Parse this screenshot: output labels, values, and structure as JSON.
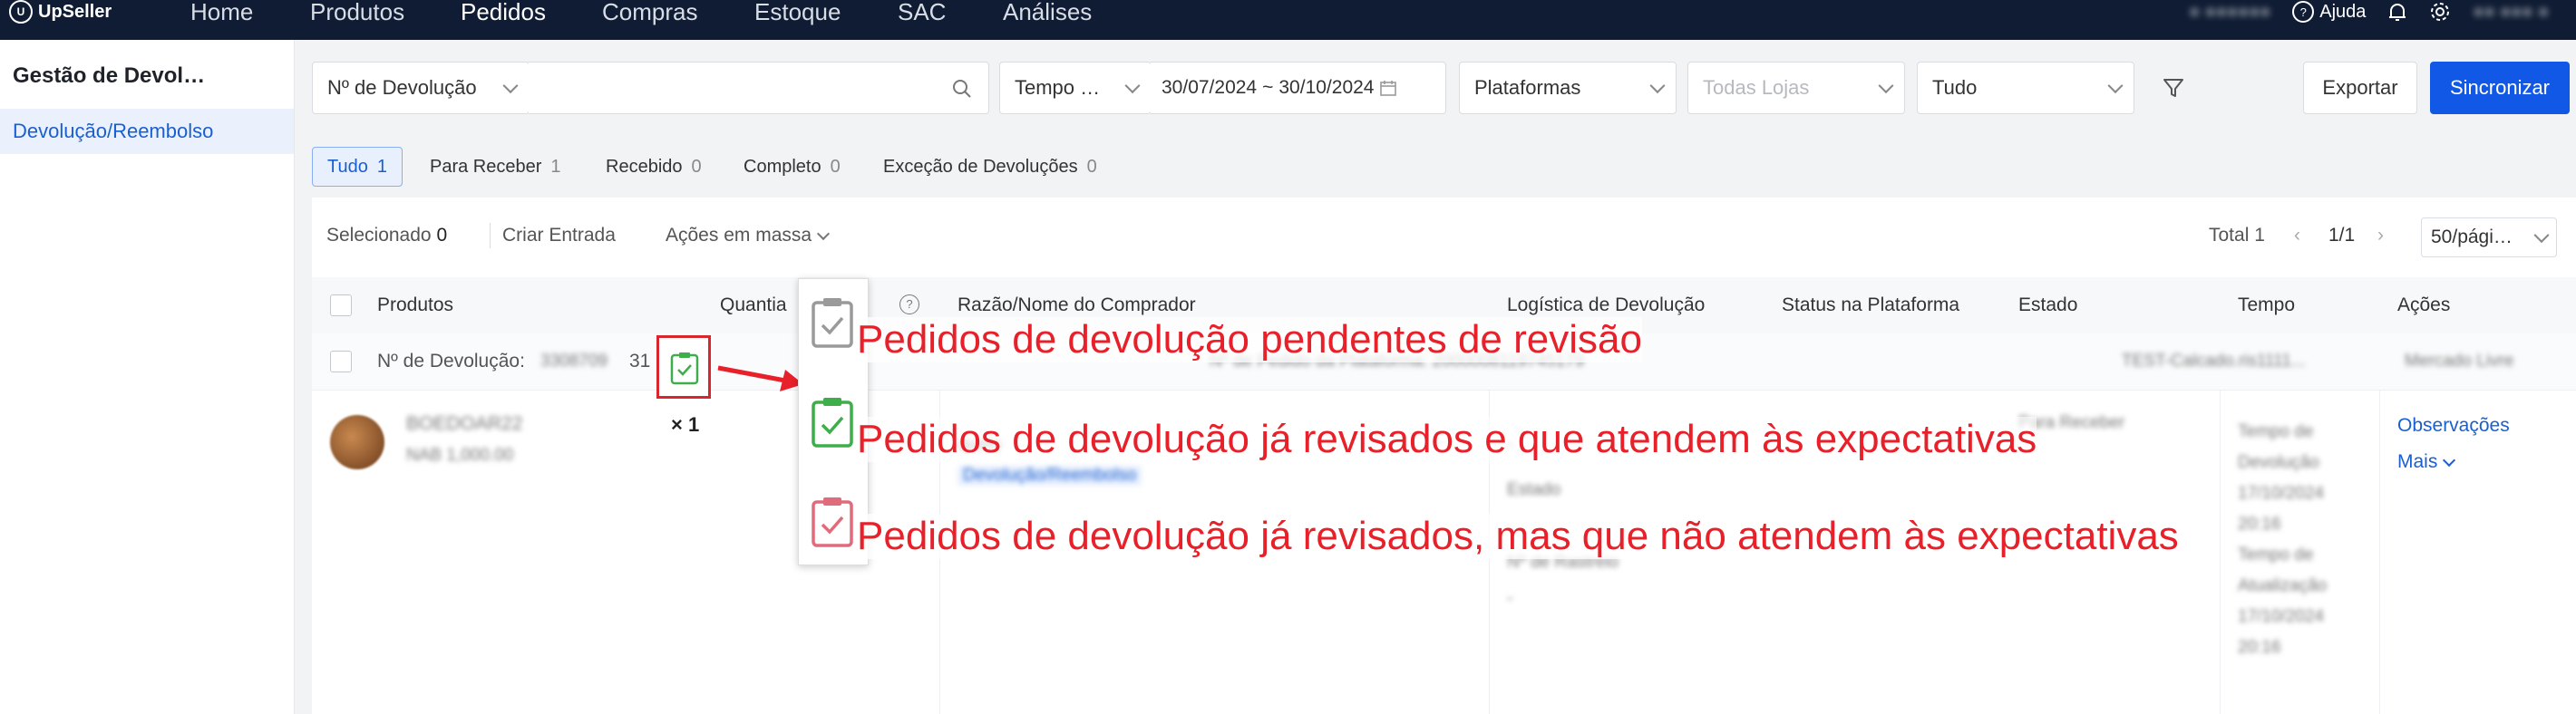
{
  "app": {
    "logo_text": "UpSeller"
  },
  "topnav": {
    "items": [
      "Home",
      "Produtos",
      "Pedidos",
      "Compras",
      "Estoque",
      "SAC",
      "Análises"
    ],
    "active": "Pedidos",
    "help_label": "Ajuda"
  },
  "sidebar": {
    "title": "Gestão de Devol…",
    "item": "Devolução/Reembolso"
  },
  "filters": {
    "search_type": "Nº de Devolução",
    "time_label": "Tempo …",
    "date_start": "30/07/2024",
    "date_sep": "~",
    "date_end": "30/10/2024",
    "platforms": "Plataformas",
    "stores_placeholder": "Todas Lojas",
    "status": "Tudo"
  },
  "actions": {
    "export": "Exportar",
    "sync": "Sincronizar"
  },
  "tabs": [
    {
      "label": "Tudo",
      "count": "1"
    },
    {
      "label": "Para Receber",
      "count": "1"
    },
    {
      "label": "Recebido",
      "count": "0"
    },
    {
      "label": "Completo",
      "count": "0"
    },
    {
      "label": "Exceção de Devoluções",
      "count": "0"
    }
  ],
  "toolbar": {
    "selected_label": "Selecionado",
    "selected_count": "0",
    "create_entry": "Criar Entrada",
    "bulk_actions": "Ações em massa",
    "total": "Total 1",
    "page": "1/1",
    "page_size": "50/pági…"
  },
  "table": {
    "headers": [
      "Produtos",
      "Quantia",
      "Razão/Nome do Comprador",
      "Logística de Devolução",
      "Status na Plataforma",
      "Estado",
      "Tempo",
      "Ações"
    ],
    "return_no_label": "Nº de Devolução:",
    "return_no_suffix": "31",
    "quantity": "× 1",
    "actions": {
      "notes": "Observações",
      "more": "Mais"
    }
  },
  "annotations": [
    "Pedidos de devolução pendentes de revisão",
    "Pedidos de devolução já revisados e que atendem às expectativas",
    "Pedidos de devolução já revisados, mas que não atendem às expectativas"
  ],
  "colors": {
    "topbar": "#0f1c33",
    "primary": "#1158e6",
    "annotation": "#e8202a",
    "check_green": "#3dae4a",
    "check_gray": "#9a9a9a",
    "check_pink": "#e06b7a"
  }
}
